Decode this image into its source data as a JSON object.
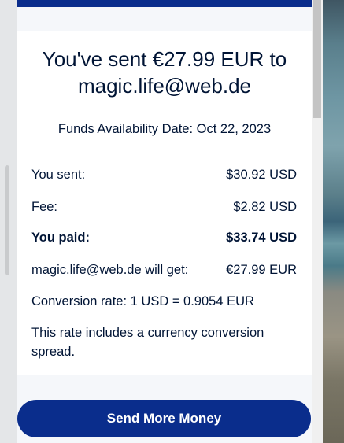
{
  "confirmation": {
    "title": "You've sent €27.99 EUR to magic.life@web.de",
    "availability": "Funds Availability Date: Oct 22, 2023",
    "rows": [
      {
        "label": "You sent:",
        "value": "$30.92 USD"
      },
      {
        "label": "Fee:",
        "value": "$2.82 USD"
      },
      {
        "label": "You paid:",
        "value": "$33.74 USD"
      },
      {
        "label": "magic.life@web.de will get:",
        "value": "€27.99 EUR"
      }
    ],
    "conversion": "Conversion rate: 1 USD = 0.9054 EUR",
    "note": "This rate includes a currency conversion spread."
  },
  "actions": {
    "send_more_label": "Send More Money"
  },
  "colors": {
    "brand": "#0a2d8c",
    "text": "#001435"
  }
}
